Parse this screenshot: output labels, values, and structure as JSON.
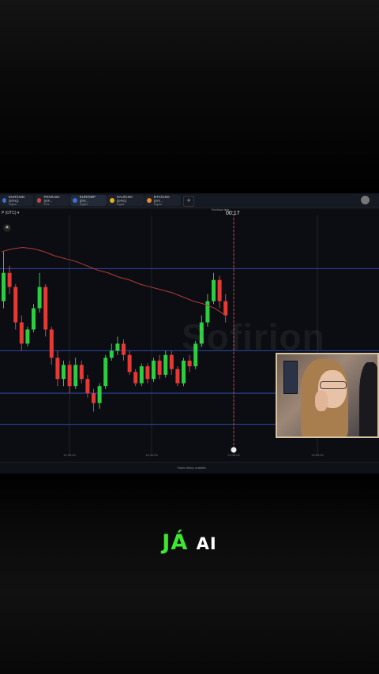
{
  "tabs": [
    {
      "name": "EUR/USD (OTC)",
      "sub": "Digital",
      "color": "#3b6ed8"
    },
    {
      "name": "PEN/USD (OT...",
      "sub": "20%",
      "color": "#c94444"
    },
    {
      "name": "EUR/GBP (OT...",
      "sub": "Digital",
      "color": "#3b6ed8"
    },
    {
      "name": "XAU/USD (OTC)",
      "sub": "Digital",
      "color": "#e0b020"
    },
    {
      "name": "BTC/USD (OT...",
      "sub": "Digital",
      "color": "#f08a24"
    }
  ],
  "plus_label": "+",
  "asset_label": "P (OTC) ▾",
  "timer_label": "Purchase time",
  "timer_value": "00:17",
  "star_label": "★",
  "watermark": "Sofirion",
  "x_ticks": [
    "13:35:00",
    "13:40:00",
    "13:45:00",
    "13:50:00"
  ],
  "footer_text": "Trades history available",
  "caption": {
    "word1": "JÁ",
    "word2": "AI"
  },
  "colors": {
    "up": "#2ecc40",
    "down": "#e53935",
    "ma": "#b23b3b",
    "hline": "#2f4aa8",
    "accent": "#3ee831"
  },
  "chart_data": {
    "type": "candlestick",
    "candles": [
      [
        0.6,
        0.8,
        0.95,
        0.55
      ],
      [
        0.8,
        0.7,
        0.85,
        0.65
      ],
      [
        0.7,
        0.45,
        0.72,
        0.4
      ],
      [
        0.45,
        0.3,
        0.5,
        0.25
      ],
      [
        0.3,
        0.4,
        0.42,
        0.28
      ],
      [
        0.4,
        0.55,
        0.58,
        0.38
      ],
      [
        0.55,
        0.7,
        0.8,
        0.52
      ],
      [
        0.7,
        0.4,
        0.72,
        0.35
      ],
      [
        0.4,
        0.2,
        0.42,
        0.15
      ],
      [
        0.2,
        0.05,
        0.25,
        0.0
      ],
      [
        0.05,
        0.15,
        0.18,
        0.0
      ],
      [
        0.15,
        0.0,
        0.18,
        -0.05
      ],
      [
        0.0,
        0.15,
        0.2,
        -0.02
      ],
      [
        0.15,
        0.05,
        0.18,
        0.02
      ],
      [
        0.05,
        -0.05,
        0.08,
        -0.08
      ],
      [
        -0.05,
        -0.12,
        -0.02,
        -0.18
      ],
      [
        -0.12,
        0.0,
        0.02,
        -0.16
      ],
      [
        0.0,
        0.2,
        0.22,
        -0.02
      ],
      [
        0.2,
        0.25,
        0.3,
        0.18
      ],
      [
        0.25,
        0.3,
        0.35,
        0.22
      ],
      [
        0.3,
        0.22,
        0.33,
        0.18
      ],
      [
        0.22,
        0.1,
        0.25,
        0.08
      ],
      [
        0.1,
        0.02,
        0.12,
        0.0
      ],
      [
        0.02,
        0.14,
        0.16,
        0.0
      ],
      [
        0.14,
        0.05,
        0.16,
        0.02
      ],
      [
        0.05,
        0.18,
        0.2,
        0.03
      ],
      [
        0.18,
        0.08,
        0.22,
        0.05
      ],
      [
        0.08,
        0.22,
        0.25,
        0.06
      ],
      [
        0.22,
        0.12,
        0.25,
        0.08
      ],
      [
        0.12,
        0.02,
        0.14,
        0.0
      ],
      [
        0.02,
        0.18,
        0.2,
        0.0
      ],
      [
        0.18,
        0.14,
        0.22,
        0.1
      ],
      [
        0.14,
        0.3,
        0.32,
        0.12
      ],
      [
        0.3,
        0.45,
        0.5,
        0.28
      ],
      [
        0.45,
        0.6,
        0.65,
        0.42
      ],
      [
        0.6,
        0.75,
        0.8,
        0.58
      ],
      [
        0.75,
        0.6,
        0.78,
        0.55
      ],
      [
        0.6,
        0.5,
        0.65,
        0.45
      ]
    ],
    "ma": [
      0.95,
      0.97,
      0.98,
      0.97,
      0.95,
      0.92,
      0.9,
      0.88,
      0.85,
      0.82,
      0.8,
      0.77,
      0.75,
      0.72,
      0.7,
      0.68,
      0.66,
      0.63,
      0.6,
      0.58,
      0.55,
      0.5
    ],
    "h_levels": [
      0.83,
      0.25,
      -0.05,
      -0.27
    ]
  }
}
